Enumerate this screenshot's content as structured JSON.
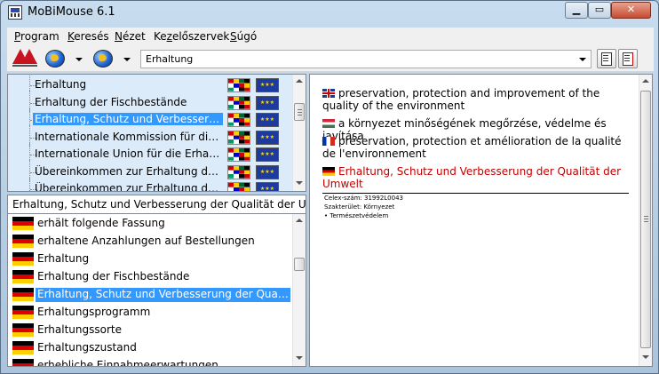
{
  "window": {
    "title": "MoBiMouse 6.1"
  },
  "menu": [
    {
      "label": "Program",
      "accel": "P",
      "rest": "rogram"
    },
    {
      "label": "Keresés",
      "accel": "K",
      "rest": "eresés"
    },
    {
      "label": "Nézet",
      "accel": "N",
      "rest": "ézet"
    },
    {
      "label": "Kezelőszervek",
      "accel": "z",
      "pre": "Ke",
      "rest": "előszervek"
    },
    {
      "label": "Súgó",
      "accel": "S",
      "rest": "úgó"
    }
  ],
  "toolbar": {
    "combo_value": "Erhaltung"
  },
  "tree": {
    "items": [
      {
        "label": "Erhaltung",
        "selected": false
      },
      {
        "label": "Erhaltung der Fischbestände",
        "selected": false
      },
      {
        "label": "Erhaltung, Schutz und Verbesseru...",
        "selected": true
      },
      {
        "label": "Internationale Kommission für die ...",
        "selected": false
      },
      {
        "label": "Internationale Union für die Erhaltu...",
        "selected": false
      },
      {
        "label": "Übereinkommen zur Erhaltung der...",
        "selected": false
      },
      {
        "label": "Übereinkommen zur Erhaltung der...",
        "selected": false
      }
    ]
  },
  "search": {
    "value": "Erhaltung, Schutz und Verbesserung der Qualität der Um"
  },
  "list": {
    "items": [
      {
        "label": "erhält folgende Fassung",
        "selected": false
      },
      {
        "label": "erhaltene Anzahlungen auf Bestellungen",
        "selected": false
      },
      {
        "label": "Erhaltung",
        "selected": false
      },
      {
        "label": "Erhaltung der Fischbestände",
        "selected": false
      },
      {
        "label": "Erhaltung, Schutz und Verbesserung der Qualit...",
        "selected": true
      },
      {
        "label": "Erhaltungsprogramm",
        "selected": false
      },
      {
        "label": "Erhaltungssorte",
        "selected": false
      },
      {
        "label": "Erhaltungszustand",
        "selected": false
      },
      {
        "label": "erhebliche Einnahmeerwartungen",
        "selected": false
      }
    ]
  },
  "detail": {
    "translations": [
      {
        "lang": "en",
        "text": "preservation, protection and improvement of the quality of the environment"
      },
      {
        "lang": "hu",
        "text": "a környezet minőségének megőrzése, védelme és javítása"
      },
      {
        "lang": "fr",
        "text": "préservation, protection et amélioration de la qualité de l'environnement"
      },
      {
        "lang": "de",
        "text": "Erhaltung, Schutz und Verbesserung der Qualität der Umwelt"
      }
    ],
    "meta": {
      "celex": "Celex-szám: 31992L0043",
      "domain": "Szakterület: Környezet",
      "subdomain": "• Természetvédelem"
    }
  },
  "colors": {
    "selection": "#3399ff",
    "german_term": "#c00000",
    "tree_bg": "#dcebfa"
  }
}
